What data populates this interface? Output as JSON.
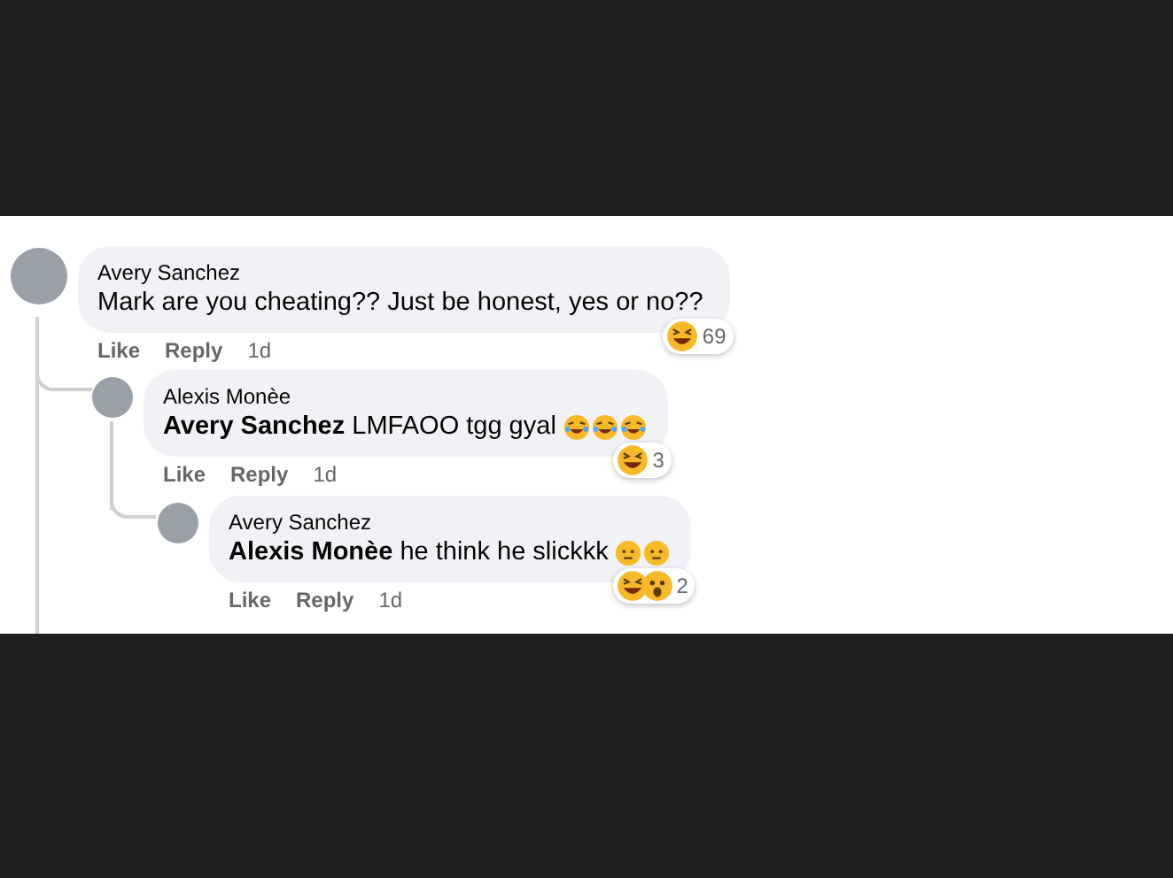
{
  "comments": [
    {
      "author": "Avery Sanchez",
      "text": "Mark are you cheating?? Just be honest, yes or no??",
      "reactions": [
        {
          "kind": "laughing"
        }
      ],
      "reaction_count": "69",
      "actions": [
        "Like",
        "Reply"
      ],
      "time": "1d",
      "children": [
        {
          "author": "Alexis Monèe",
          "text": "**Avery Sanchez** LMFAOO tgg gyal",
          "emojis": [
            {
              "kind": "tears_of_joy"
            },
            {
              "kind": "tears_of_joy"
            },
            {
              "kind": "tears_of_joy"
            }
          ],
          "reactions": [
            {
              "kind": "laughing"
            }
          ],
          "reaction_count": "3",
          "actions": [
            "Like",
            "Reply"
          ],
          "time": "1d",
          "children": [
            {
              "author": "Avery Sanchez",
              "text": "**Alexis Monèe** he think he slickkk",
              "emojis": [
                {
                  "kind": "neutral"
                },
                {
                  "kind": "neutral"
                }
              ],
              "reactions": [
                {
                  "kind": "laughing"
                },
                {
                  "kind": "wow"
                }
              ],
              "reaction_count": "2",
              "actions": [
                "Like",
                "Reply"
              ],
              "time": "1d"
            }
          ]
        }
      ]
    }
  ]
}
